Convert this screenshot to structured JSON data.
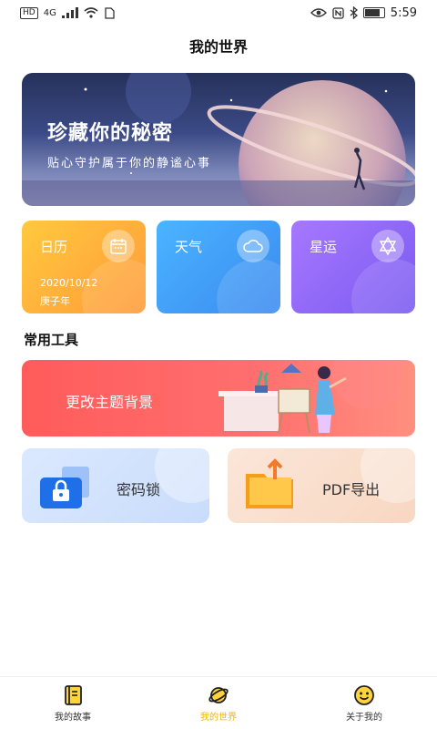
{
  "status_bar": {
    "hd": "HD",
    "network": "4G",
    "time": "5:59"
  },
  "header": {
    "title": "我的世界"
  },
  "banner": {
    "title": "珍藏你的秘密",
    "subtitle": "贴心守护属于你的静谧心事"
  },
  "cards": [
    {
      "label": "日历",
      "date": "2020/10/12",
      "year": "庚子年",
      "icon": "calendar-icon",
      "color_start": "#ffc93d",
      "color_end": "#ff9a3a"
    },
    {
      "label": "天气",
      "icon": "cloud-icon",
      "color_start": "#4ab4ff",
      "color_end": "#3b8af0"
    },
    {
      "label": "星运",
      "icon": "star-of-david-icon",
      "color_start": "#a778ff",
      "color_end": "#7a5af0"
    }
  ],
  "tools_section": {
    "title": "常用工具",
    "theme_label": "更改主题背景",
    "lock_label": "密码锁",
    "pdf_label": "PDF导出"
  },
  "bottom_nav": {
    "items": [
      {
        "label": "我的故事",
        "icon": "notebook-icon",
        "active": false
      },
      {
        "label": "我的世界",
        "icon": "planet-icon",
        "active": true
      },
      {
        "label": "关于我的",
        "icon": "smiley-icon",
        "active": false
      }
    ]
  },
  "colors": {
    "accent": "#f2b600",
    "theme_card": "#ff5b5b"
  }
}
